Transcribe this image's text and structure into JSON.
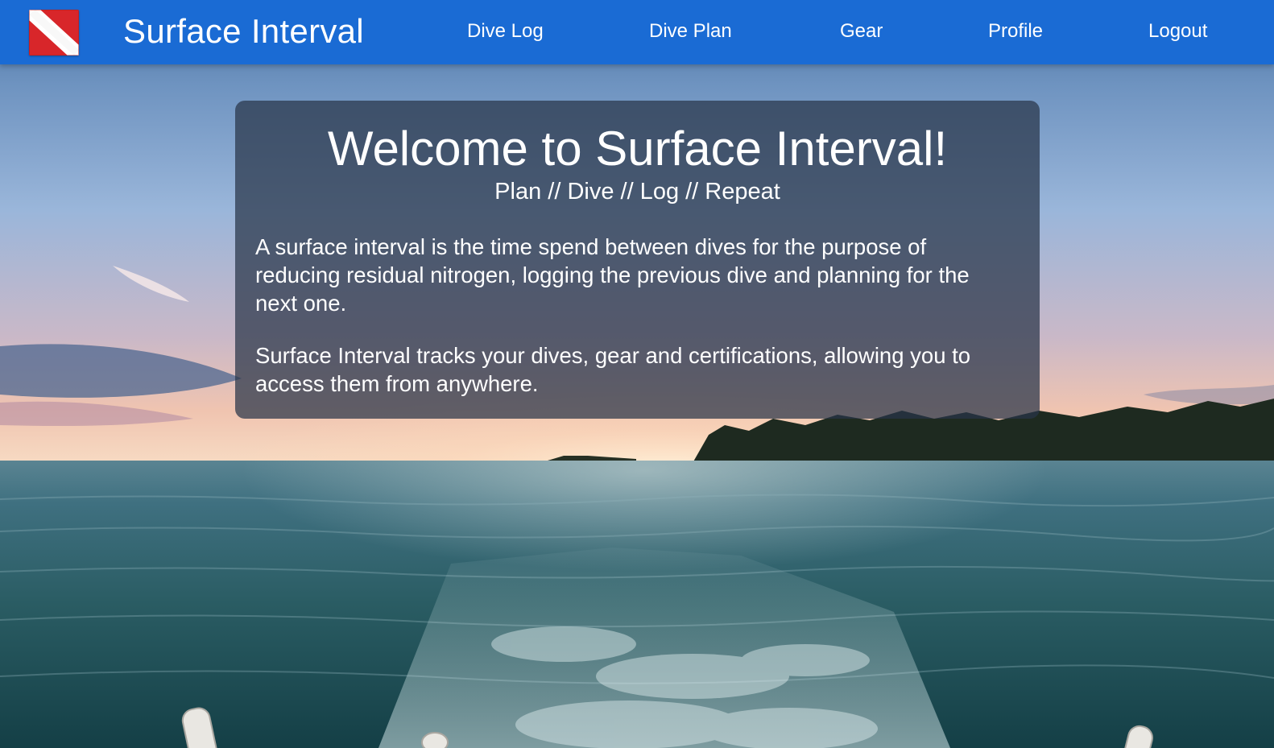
{
  "header": {
    "brand": "Surface Interval",
    "nav": [
      {
        "label": "Dive Log"
      },
      {
        "label": "Dive Plan"
      },
      {
        "label": "Gear"
      },
      {
        "label": "Profile"
      },
      {
        "label": "Logout"
      }
    ]
  },
  "icons": {
    "logo": "dive-flag-icon"
  },
  "colors": {
    "navbar": "#1a6bd4",
    "flag_red": "#d8262a",
    "flag_stripe": "#ffffff",
    "card_bg": "rgba(40,52,72,0.72)"
  },
  "welcome": {
    "title": "Welcome to Surface Interval!",
    "subtitle": "Plan // Dive // Log // Repeat",
    "paragraphs": [
      "A surface interval is the time spend between dives for the purpose of reducing residual nitrogen, logging the previous dive and planning for the next one.",
      "Surface Interval tracks your dives, gear and certifications, allowing you to access them from anywhere."
    ]
  }
}
